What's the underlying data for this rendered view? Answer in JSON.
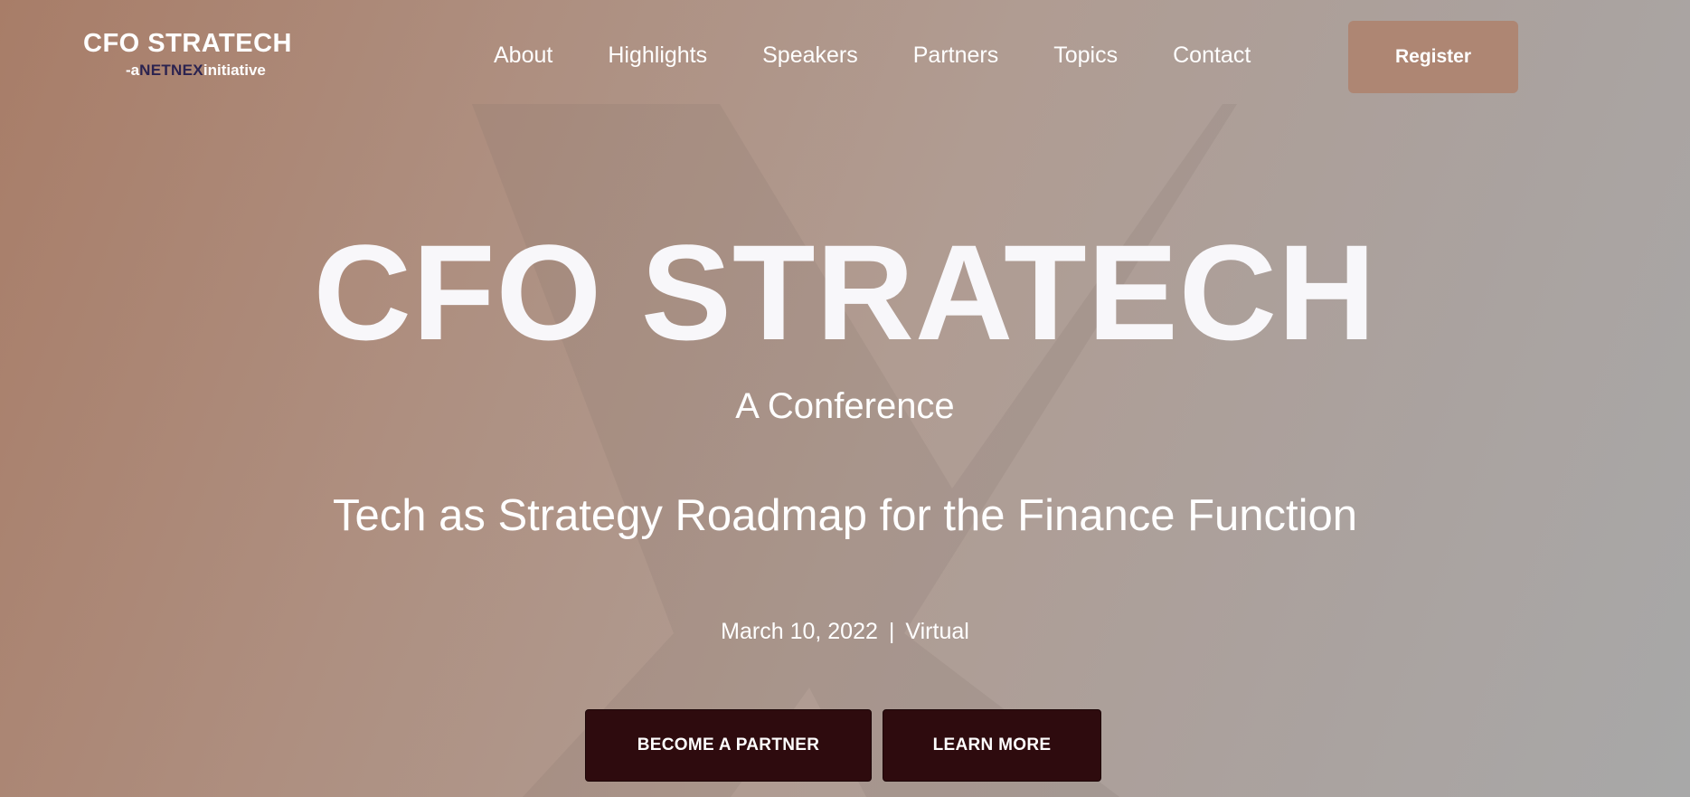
{
  "logo": {
    "title": "CFO STRATECH",
    "prefix": "-a",
    "brand": "NETNEX",
    "suffix": "initiative"
  },
  "nav": {
    "items": [
      "About",
      "Highlights",
      "Speakers",
      "Partners",
      "Topics",
      "Contact"
    ]
  },
  "register": {
    "label": "Register"
  },
  "hero": {
    "title": "CFO STRATECH",
    "subtitle": "A Conference",
    "tagline": "Tech as Strategy Roadmap for the Finance Function",
    "date": "March 10, 2022",
    "separator": "|",
    "location": "Virtual"
  },
  "cta": {
    "partner_label": "BECOME A PARTNER",
    "learn_label": "LEARN MORE"
  },
  "colors": {
    "register_bg": "#ae8673",
    "cta_bg": "#2e0b0e",
    "brand_text": "#2b2350"
  }
}
